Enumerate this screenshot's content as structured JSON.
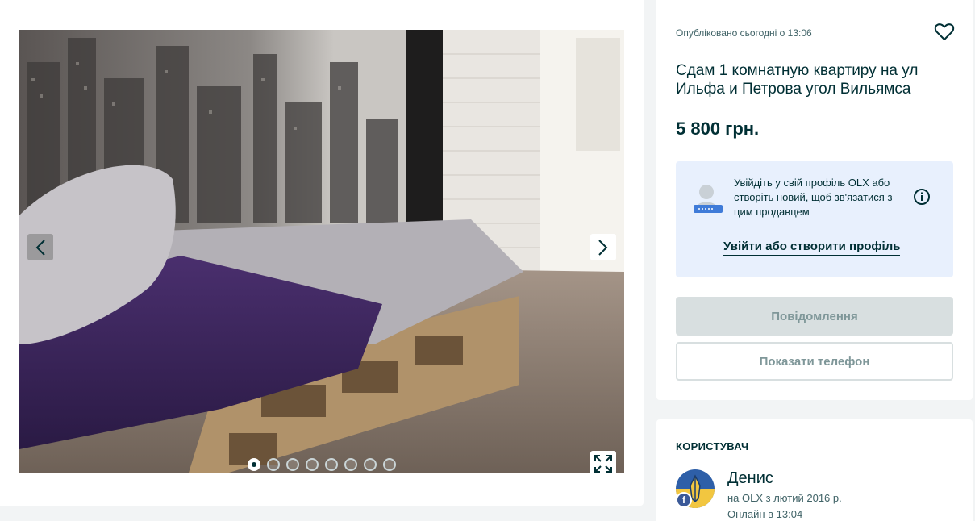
{
  "gallery": {
    "photo_alt": "",
    "image_count": 8,
    "active_index": 0
  },
  "listing": {
    "posted": "Опубліковано сьогодні о 13:06",
    "title": "Сдам 1 комнатную квартиру на ул Ильфа и Петрова угол Вильямса",
    "price": "5 800 грн."
  },
  "login_prompt": {
    "text": "Увійдіть у свій профіль OLX або створіть новий, щоб зв'язатися з цим продавцем",
    "link": "Увійти або створити профіль"
  },
  "actions": {
    "message": "Повідомлення",
    "phone": "Показати телефон"
  },
  "user": {
    "heading": "КОРИСТУВАЧ",
    "name": "Денис",
    "since": "на OLX з лютий 2016 р.",
    "online": "Онлайн в 13:04"
  },
  "icons": {
    "prev": "chevron-left-icon",
    "next": "chevron-right-icon",
    "fullscreen": "expand-icon",
    "favorite": "heart-icon",
    "info": "info-icon"
  },
  "colors": {
    "brand_dark": "#002f34",
    "login_bg": "#e8f0fd",
    "button_disabled": "#d8dfe0",
    "facebook": "#3b5998"
  }
}
